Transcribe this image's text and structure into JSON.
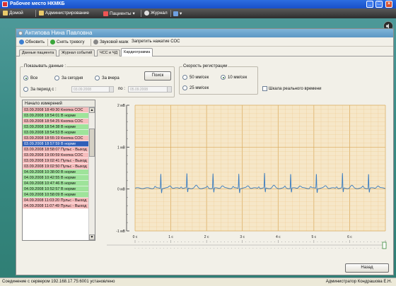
{
  "app": {
    "title": "Рабочее место НКМКБ"
  },
  "window_buttons": {
    "minimize": "_",
    "maximize": "□",
    "close": "×"
  },
  "menu": {
    "home": "Домой",
    "admin": "Администрирование",
    "patients": "Пациенты",
    "journal": "Журнал"
  },
  "patient": {
    "name": "Антипова Нина Павловна"
  },
  "toolbar": {
    "refresh": "Обновить",
    "clear_alarm": "Снять тревогу",
    "sound_mask": "Звуковой маяк",
    "block_sos": "Запретить нажатие СОС"
  },
  "tabs": [
    "Данные пациента",
    "Журнал событий",
    "ЧСС и ЧД",
    "Кардиограмма"
  ],
  "show_data": {
    "label": "Показывать данные :",
    "all": "Все",
    "today": "За сегодня",
    "yesterday": "За вчера",
    "period": "За период с :",
    "to": "по :",
    "date_from": "03.09.2008",
    "date_to": "05.09.2008",
    "search": "Поиск"
  },
  "speed": {
    "label": "Скорость регистрации",
    "s50": "50 мм/сек",
    "s10": "10 мм/сек",
    "s25": "25 мм/сек",
    "realtime": "Шкала реального времени"
  },
  "list": {
    "header": "Начало измерений",
    "rows": [
      {
        "text": "03.09.2008 18:49:30 Кнопка СОС",
        "kind": "p"
      },
      {
        "text": "03.09.2008 18:54:01 В норме",
        "kind": "g"
      },
      {
        "text": "03.09.2008 18:54:25 Кнопка СОС",
        "kind": "p"
      },
      {
        "text": "03.09.2008 18:54:38 В норме",
        "kind": "g"
      },
      {
        "text": "03.09.2008 18:54:53 В норме",
        "kind": "g"
      },
      {
        "text": "03.09.2008 18:55:19 Кнопка СОС",
        "kind": "p"
      },
      {
        "text": "03.09.2008 18:57:59 В норме",
        "kind": "s"
      },
      {
        "text": "03.09.2008 18:58:07 Пульс - Выход",
        "kind": "p"
      },
      {
        "text": "03.09.2008 19:00:59 Кнопка СОС",
        "kind": "p"
      },
      {
        "text": "03.09.2008 19:02:41 Пульс - Выход",
        "kind": "p"
      },
      {
        "text": "03.09.2008 19:02:50 Пульс - Выход",
        "kind": "p"
      },
      {
        "text": "04.09.2008 10:38:00 В норме",
        "kind": "g"
      },
      {
        "text": "04.09.2008 10:42:55 В норме",
        "kind": "g"
      },
      {
        "text": "04.09.2008 10:47:46 В норме",
        "kind": "g"
      },
      {
        "text": "04.09.2008 10:52:57 В норме",
        "kind": "g"
      },
      {
        "text": "04.09.2008 10:58:09 В норме",
        "kind": "g"
      },
      {
        "text": "04.09.2008 11:03:20 Пульс - Выход",
        "kind": "p"
      },
      {
        "text": "04.09.2008 11:07:49 Пульс - Выход",
        "kind": "p"
      }
    ]
  },
  "chart_data": {
    "type": "line",
    "ylabel": "",
    "y_ticks": [
      "2 мВ",
      "1 мВ",
      "0 мВ",
      "-1 мВ"
    ],
    "x_ticks": [
      "0 с",
      "1 с",
      "2 с",
      "3 с",
      "4 с",
      "5 с",
      "6 с"
    ],
    "ylim": [
      -1,
      2
    ],
    "xlim": [
      0,
      7
    ],
    "r_peaks_s": [
      0.72,
      1.45,
      2.18,
      2.9,
      3.62,
      4.35,
      5.07,
      5.8,
      6.53
    ],
    "baseline_mv": 0.02,
    "r_amplitude_mv": 0.35,
    "grid": true,
    "colors": {
      "background": "#f6e7c8",
      "minor_grid": "#ecc88e",
      "major_grid": "#d9a95a",
      "trace": "#3c7dc0"
    }
  },
  "slider": {
    "ticks": [
      "0 с",
      "1 с",
      "2 с",
      "3 с",
      "4 с",
      "5 с",
      "6 с"
    ],
    "position": 1.0
  },
  "back_button": "Назад",
  "status": {
    "left": "Соединение с сервером 192.168.17.75:6001 установлено",
    "right": "Администратор Кондрашова Е.Н."
  }
}
